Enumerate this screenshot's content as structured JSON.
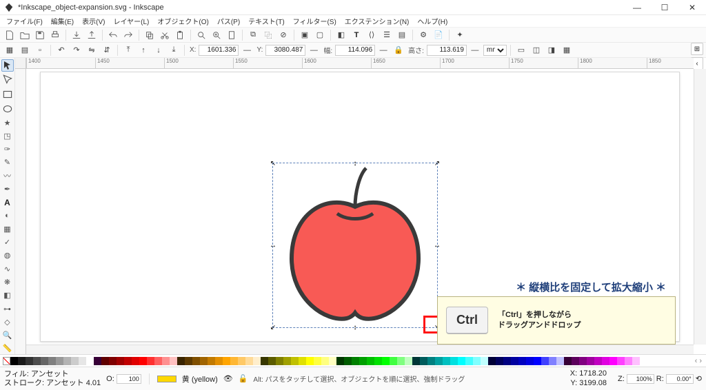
{
  "window": {
    "title": "*Inkscape_object-expansion.svg - Inkscape"
  },
  "menu": {
    "items": [
      "ファイル(F)",
      "編集(E)",
      "表示(V)",
      "レイヤー(L)",
      "オブジェクト(O)",
      "パス(P)",
      "テキスト(T)",
      "フィルター(S)",
      "エクステンション(N)",
      "ヘルプ(H)"
    ]
  },
  "coords": {
    "x_label": "X:",
    "x": "1601.336",
    "y_label": "Y:",
    "y": "3080.487",
    "w_label": "幅:",
    "w": "114.096",
    "h_label": "高さ:",
    "h": "113.619",
    "unit": "mm"
  },
  "ruler": {
    "marks": [
      "1400",
      "1450",
      "1500",
      "1550",
      "1600",
      "1650",
      "1700",
      "1750",
      "1800",
      "1850"
    ]
  },
  "annotation": {
    "title": "＊ 縦横比を固定して拡大縮小 ＊",
    "key": "Ctrl",
    "line1": "「Ctrl」を押しながら",
    "line2": "ドラッグアンドドロップ"
  },
  "status": {
    "fill_label": "フィル:",
    "stroke_label": "ストローク:",
    "fill_value": "アンセット",
    "stroke_value": "アンセット",
    "stroke_width": "4.01",
    "opacity_label": "O:",
    "opacity": "100",
    "swatch_name": "黄 (yellow)",
    "hint": "Alt: パスをタッチして選択、オブジェクトを順に選択、強制ドラッグ",
    "cursor_x_label": "X:",
    "cursor_x": "1718.20",
    "cursor_y_label": "Y:",
    "cursor_y": "3199.08",
    "zoom": "100%",
    "rotation_label": "R:",
    "rotation": "0.00°"
  },
  "palette_colors": [
    "#000000",
    "#1a1a1a",
    "#333333",
    "#4d4d4d",
    "#666666",
    "#808080",
    "#999999",
    "#b3b3b3",
    "#cccccc",
    "#e6e6e6",
    "#ffffff",
    "#370037",
    "#5f0000",
    "#7f0000",
    "#a00000",
    "#c00000",
    "#e00000",
    "#ff0000",
    "#ff3030",
    "#ff6060",
    "#ff9090",
    "#ffc0c0",
    "#3a2400",
    "#5c3900",
    "#7f4f00",
    "#a06400",
    "#c27a00",
    "#e38f00",
    "#ffa500",
    "#ffb733",
    "#ffc966",
    "#ffdb99",
    "#ffeecc",
    "#373700",
    "#5c5c00",
    "#808000",
    "#a0a000",
    "#c0c000",
    "#e0e000",
    "#ffff00",
    "#ffff40",
    "#ffff80",
    "#ffffc0",
    "#003700",
    "#005c00",
    "#008000",
    "#00a000",
    "#00c000",
    "#00e000",
    "#00ff00",
    "#40ff40",
    "#80ff80",
    "#c0ffc0",
    "#003737",
    "#005c5c",
    "#008080",
    "#00a0a0",
    "#00c0c0",
    "#00e0e0",
    "#00ffff",
    "#40ffff",
    "#80ffff",
    "#c0ffff",
    "#000037",
    "#00005c",
    "#000080",
    "#0000a0",
    "#0000c0",
    "#0000e0",
    "#0000ff",
    "#4040ff",
    "#8080ff",
    "#c0c0ff",
    "#370037",
    "#5c005c",
    "#800080",
    "#a000a0",
    "#c000c0",
    "#e000e0",
    "#ff00ff",
    "#ff40ff",
    "#ff80ff",
    "#ffc0ff"
  ]
}
